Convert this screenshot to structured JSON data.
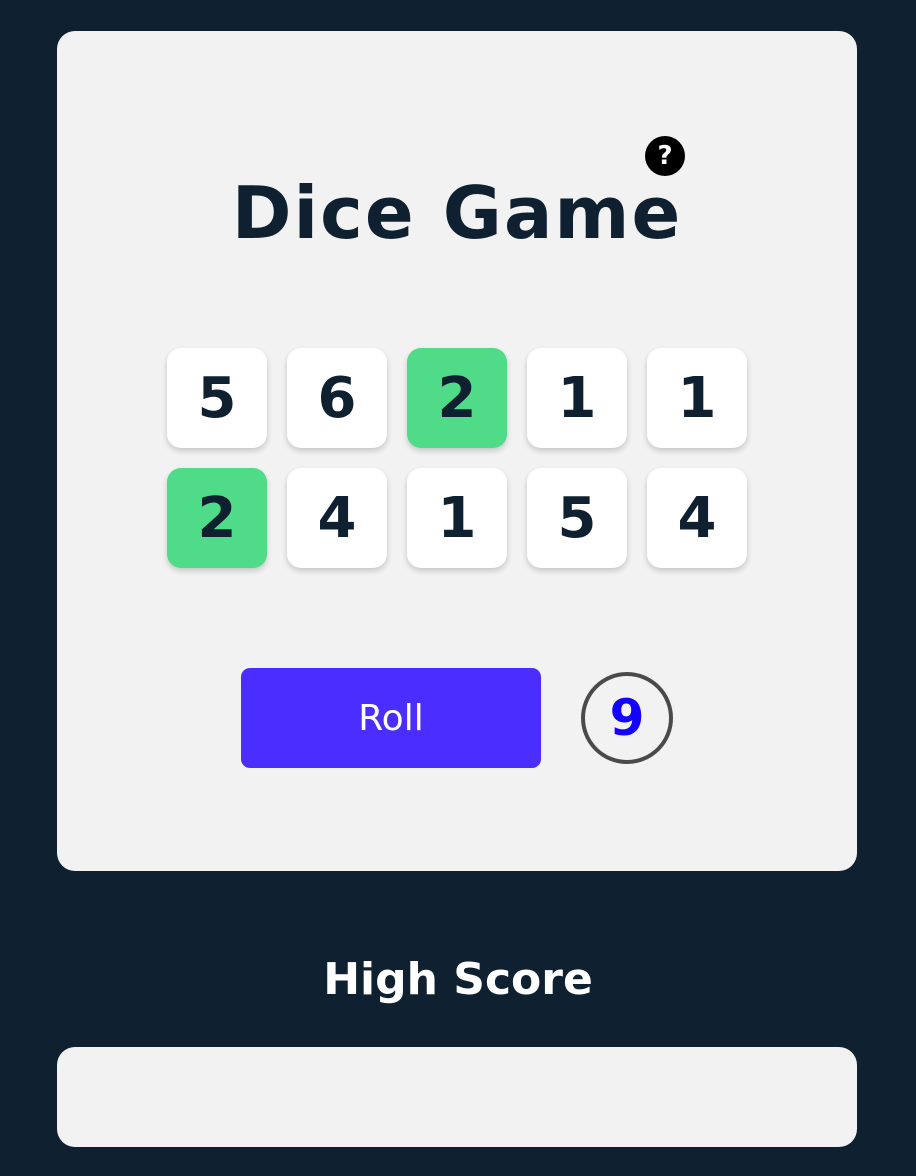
{
  "game": {
    "title": "Dice Game",
    "help_label": "?",
    "dice": [
      {
        "value": "5",
        "held": false
      },
      {
        "value": "6",
        "held": false
      },
      {
        "value": "2",
        "held": true
      },
      {
        "value": "1",
        "held": false
      },
      {
        "value": "1",
        "held": false
      },
      {
        "value": "2",
        "held": true
      },
      {
        "value": "4",
        "held": false
      },
      {
        "value": "1",
        "held": false
      },
      {
        "value": "5",
        "held": false
      },
      {
        "value": "4",
        "held": false
      }
    ],
    "roll_label": "Roll",
    "roll_count": "9"
  },
  "high_score": {
    "title": "High Score"
  },
  "colors": {
    "background": "#0f2130",
    "card": "#f2f2f2",
    "held_die": "#4fdb88",
    "roll_button": "#4a2dff",
    "roll_count": "#1400ff"
  }
}
